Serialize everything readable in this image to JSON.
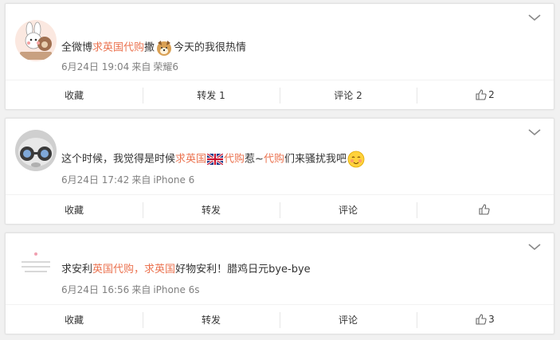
{
  "posts": [
    {
      "nickname": "",
      "text": {
        "p1": "全微博",
        "h1": "求英国代购",
        "p2": "撒",
        "p3": "今天的我很热情"
      },
      "meta": {
        "time": "6月24日 19:04",
        "from": "来自",
        "device": "荣耀6"
      },
      "actions": {
        "favorite": "收藏",
        "repost": "转发 1",
        "comment": "评论 2",
        "like": "2"
      }
    },
    {
      "nickname": "",
      "text": {
        "p1": "这个时候，我觉得是时候",
        "h1": "求英国",
        "h2": "代购",
        "p2": "惹~",
        "h3": "代购",
        "p3": "们来骚扰我吧"
      },
      "meta": {
        "time": "6月24日 17:42",
        "from": "来自",
        "device": "iPhone 6"
      },
      "actions": {
        "favorite": "收藏",
        "repost": "转发",
        "comment": "评论",
        "like": ""
      }
    },
    {
      "nickname": "",
      "text": {
        "p1": "求安利",
        "h1": "英国代购",
        "p2": "，",
        "h2": "求英国",
        "p3": "好物安利！腊鸡日元bye-bye"
      },
      "meta": {
        "time": "6月24日 16:56",
        "from": "来自",
        "device": "iPhone 6s"
      },
      "actions": {
        "favorite": "收藏",
        "repost": "转发",
        "comment": "评论",
        "like": "3"
      }
    }
  ],
  "colors": {
    "highlight": "#eb7350",
    "meta": "#808080",
    "background": "#f1f1f1"
  },
  "icons": [
    "chevron-down-icon",
    "thumb-up-icon",
    "dog-emoji-icon",
    "uk-flag-icon",
    "shy-emoji-icon"
  ]
}
